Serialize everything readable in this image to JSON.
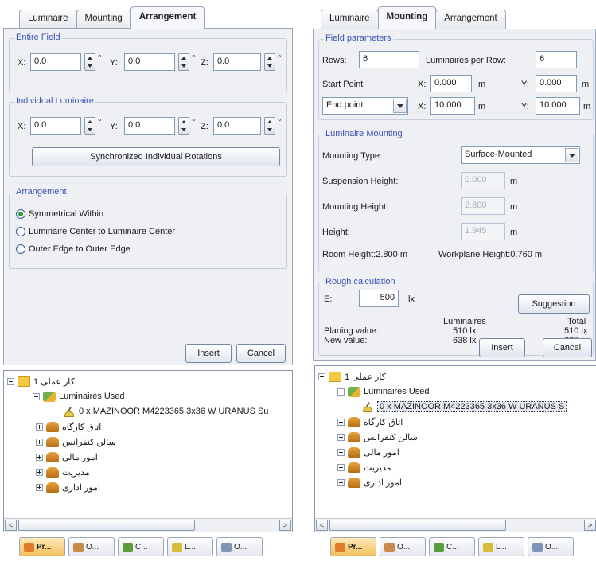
{
  "left": {
    "tabs": [
      "Luminaire",
      "Mounting",
      "Arrangement"
    ],
    "entire_field": {
      "title": "Entire Field",
      "x_label": "X:",
      "x_value": "0.0",
      "y_label": "Y:",
      "y_value": "0.0",
      "z_label": "Z:",
      "z_value": "0.0",
      "unit": "°"
    },
    "individual_luminaire": {
      "title": "Individual Luminaire",
      "x_label": "X:",
      "x_value": "0.0",
      "y_label": "Y:",
      "y_value": "0.0",
      "z_label": "Z:",
      "z_value": "0.0",
      "unit": "°",
      "sync_button": "Synchronized Individual Rotations"
    },
    "arrangement": {
      "title": "Arrangement",
      "options": [
        "Symmetrical Within",
        "Luminaire Center to Luminaire Center",
        "Outer Edge to Outer Edge"
      ],
      "selected": "Symmetrical Within"
    },
    "insert_button": "Insert",
    "cancel_button": "Cancel",
    "tree": {
      "root": "کار عملی 1",
      "luminaires_used": "Luminaires Used",
      "luminaire_item": "0 x MAZINOOR M4223365 3x36 W URANUS Su",
      "rooms": [
        "اتاق کارگاه",
        "سالن کنفرانس",
        "امور مالی",
        "مدیریت",
        "امور اداری"
      ]
    },
    "bottom_tabs": [
      "Pr...",
      "O...",
      "C...",
      "L...",
      "O..."
    ],
    "scroll_left": "<",
    "scroll_right": ">"
  },
  "right": {
    "tabs": [
      "Luminaire",
      "Mounting",
      "Arrangement"
    ],
    "field_parameters": {
      "title": "Field parameters",
      "rows_label": "Rows:",
      "rows_value": "6",
      "per_row_label": "Luminaires per Row:",
      "per_row_value": "6",
      "start_point_label": "Start Point",
      "start_x_label": "X:",
      "start_x_value": "0.000",
      "start_y_label": "Y:",
      "start_y_value": "0.000",
      "end_point_select": "End point",
      "end_x_label": "X:",
      "end_x_value": "10.000",
      "end_y_label": "Y:",
      "end_y_value": "10.000",
      "unit_m": "m"
    },
    "luminaire_mounting": {
      "title": "Luminaire Mounting",
      "mounting_type_label": "Mounting Type:",
      "mounting_type_value": "Surface-Mounted",
      "suspension_label": "Suspension Height:",
      "suspension_value": "0.000",
      "mounting_height_label": "Mounting Height:",
      "mounting_height_value": "2.800",
      "height_label": "Height:",
      "height_value": "1.945",
      "unit_m": "m",
      "room_height": "Room Height:2.800 m",
      "workplane_height": "Workplane Height:0.760 m"
    },
    "rough_calculation": {
      "title": "Rough calculation",
      "e_label": "E:",
      "e_value": "500",
      "e_unit": "lx",
      "suggestion_button": "Suggestion",
      "col_luminaires": "Luminaires",
      "col_total": "Total",
      "planing_label": "Planing value:",
      "planing_luminaires": "510 lx",
      "planing_total": "510 lx",
      "new_label": "New value:",
      "new_luminaires": "638 lx",
      "new_total": "638 lx"
    },
    "insert_button": "Insert",
    "cancel_button": "Cancel",
    "tree": {
      "root": "کار عملی 1",
      "luminaires_used": "Luminaires Used",
      "luminaire_item": "0 x MAZINOOR M4223365 3x36 W URANUS S",
      "rooms": [
        "اتاق کارگاه",
        "سالن کنفرانس",
        "امور مالی",
        "مدیریت",
        "امور اداری"
      ]
    },
    "bottom_tabs": [
      "Pr...",
      "O...",
      "C...",
      "L...",
      "O..."
    ],
    "scroll_left": "<",
    "scroll_right": ">"
  }
}
